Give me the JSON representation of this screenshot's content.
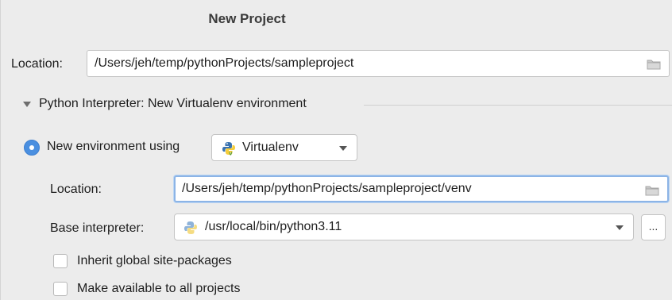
{
  "dialog": {
    "title": "New Project"
  },
  "project_location": {
    "label": "Location:",
    "value": "/Users/jeh/temp/pythonProjects/sampleproject"
  },
  "interpreter_section": {
    "title": "Python Interpreter: New Virtualenv environment",
    "expanded": true
  },
  "new_environment": {
    "radio_label": "New environment using",
    "selected": true,
    "tool": "Virtualenv"
  },
  "venv_location": {
    "label": "Location:",
    "value": "/Users/jeh/temp/pythonProjects/sampleproject/venv"
  },
  "base_interpreter": {
    "label": "Base interpreter:",
    "value": "/usr/local/bin/python3.11",
    "browse_label": "..."
  },
  "options": {
    "inherit_label": "Inherit global site-packages",
    "inherit_checked": false,
    "make_available_label": "Make available to all projects",
    "make_available_checked": false
  },
  "colors": {
    "accent": "#4a8fe0",
    "focus_border": "#8cb4e6",
    "background": "#ececec",
    "python_blue": "#3a73b0",
    "python_yellow": "#f5cd3c"
  },
  "icons": {
    "folder": "folder-icon",
    "python": "python-logo-icon",
    "dropdown": "chevron-down-icon"
  }
}
